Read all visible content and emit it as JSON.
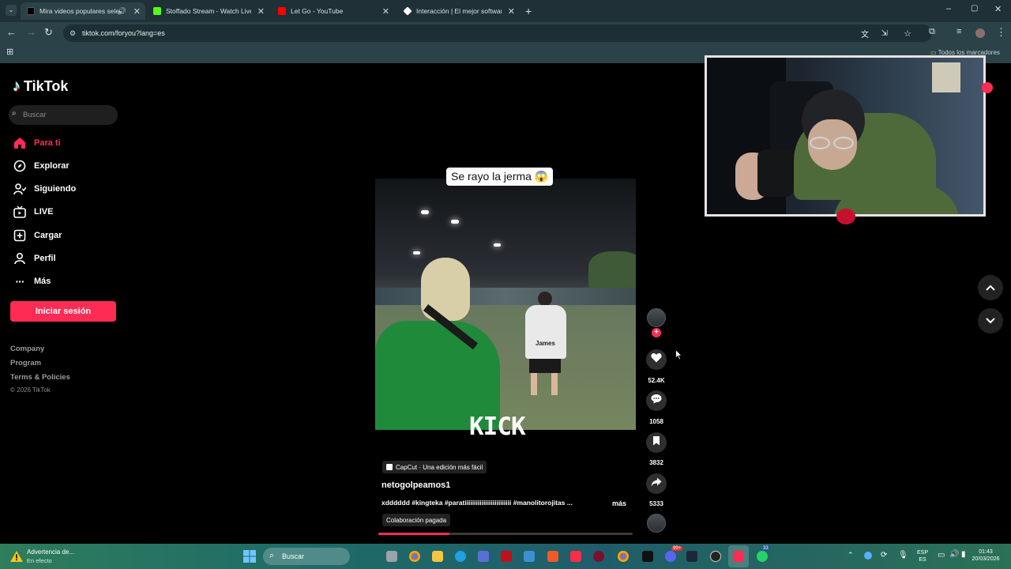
{
  "browser": {
    "tabs": [
      {
        "title": "Mira videos populares selec",
        "favicon_color": "#000000"
      },
      {
        "title": "Stoffado Stream - Watch Live o",
        "favicon_color": "#53fc18"
      },
      {
        "title": "Let Go - YouTube",
        "favicon_color": "#ff0000"
      },
      {
        "title": "Interacción | El mejor software",
        "favicon_color": "#ffffff"
      }
    ],
    "url": "tiktok.com/foryou?lang=es",
    "bookmarks_label": "Todos los marcadores"
  },
  "sidebar": {
    "logo": "TikTok",
    "search_placeholder": "Buscar",
    "nav": [
      {
        "label": "Para ti",
        "icon": "home-icon",
        "active": true
      },
      {
        "label": "Explorar",
        "icon": "compass-icon"
      },
      {
        "label": "Siguiendo",
        "icon": "following-icon"
      },
      {
        "label": "LIVE",
        "icon": "live-icon"
      },
      {
        "label": "Cargar",
        "icon": "upload-icon"
      },
      {
        "label": "Perfil",
        "icon": "profile-icon"
      },
      {
        "label": "Más",
        "icon": "more-icon"
      }
    ],
    "login_button": "Iniciar sesión",
    "footer": [
      "Company",
      "Program",
      "Terms & Policies"
    ],
    "copyright": "© 2026 TikTok"
  },
  "video": {
    "overlay_caption": "Se rayo la jerma 😱",
    "watermark": "KICK",
    "jersey_text": "James",
    "capcut_label": "CapCut · Una edición más fácil",
    "username": "netogolpeamos1",
    "description": "xdddddd #kingteka #paratiiiiiiiiiiiiiiiiiiiiiiiii #manolitorojitas ...",
    "more_label": "más",
    "paid_label": "Colaboración pagada",
    "progress_fraction": 0.28
  },
  "actions": {
    "likes": "52.4K",
    "comments": "1058",
    "saves": "3832",
    "shares": "5333"
  },
  "taskbar": {
    "warning_title": "Advertencia de...",
    "warning_sub": "En efecto",
    "search_label": "Buscar",
    "lang_top": "ESP",
    "lang_bottom": "ES",
    "time": "01:43",
    "date": "20/03/2026",
    "badge_discord": "99+",
    "badge_whatsapp": "33"
  },
  "colors": {
    "accent": "#fe2c55",
    "chrome": "#2a4248"
  }
}
